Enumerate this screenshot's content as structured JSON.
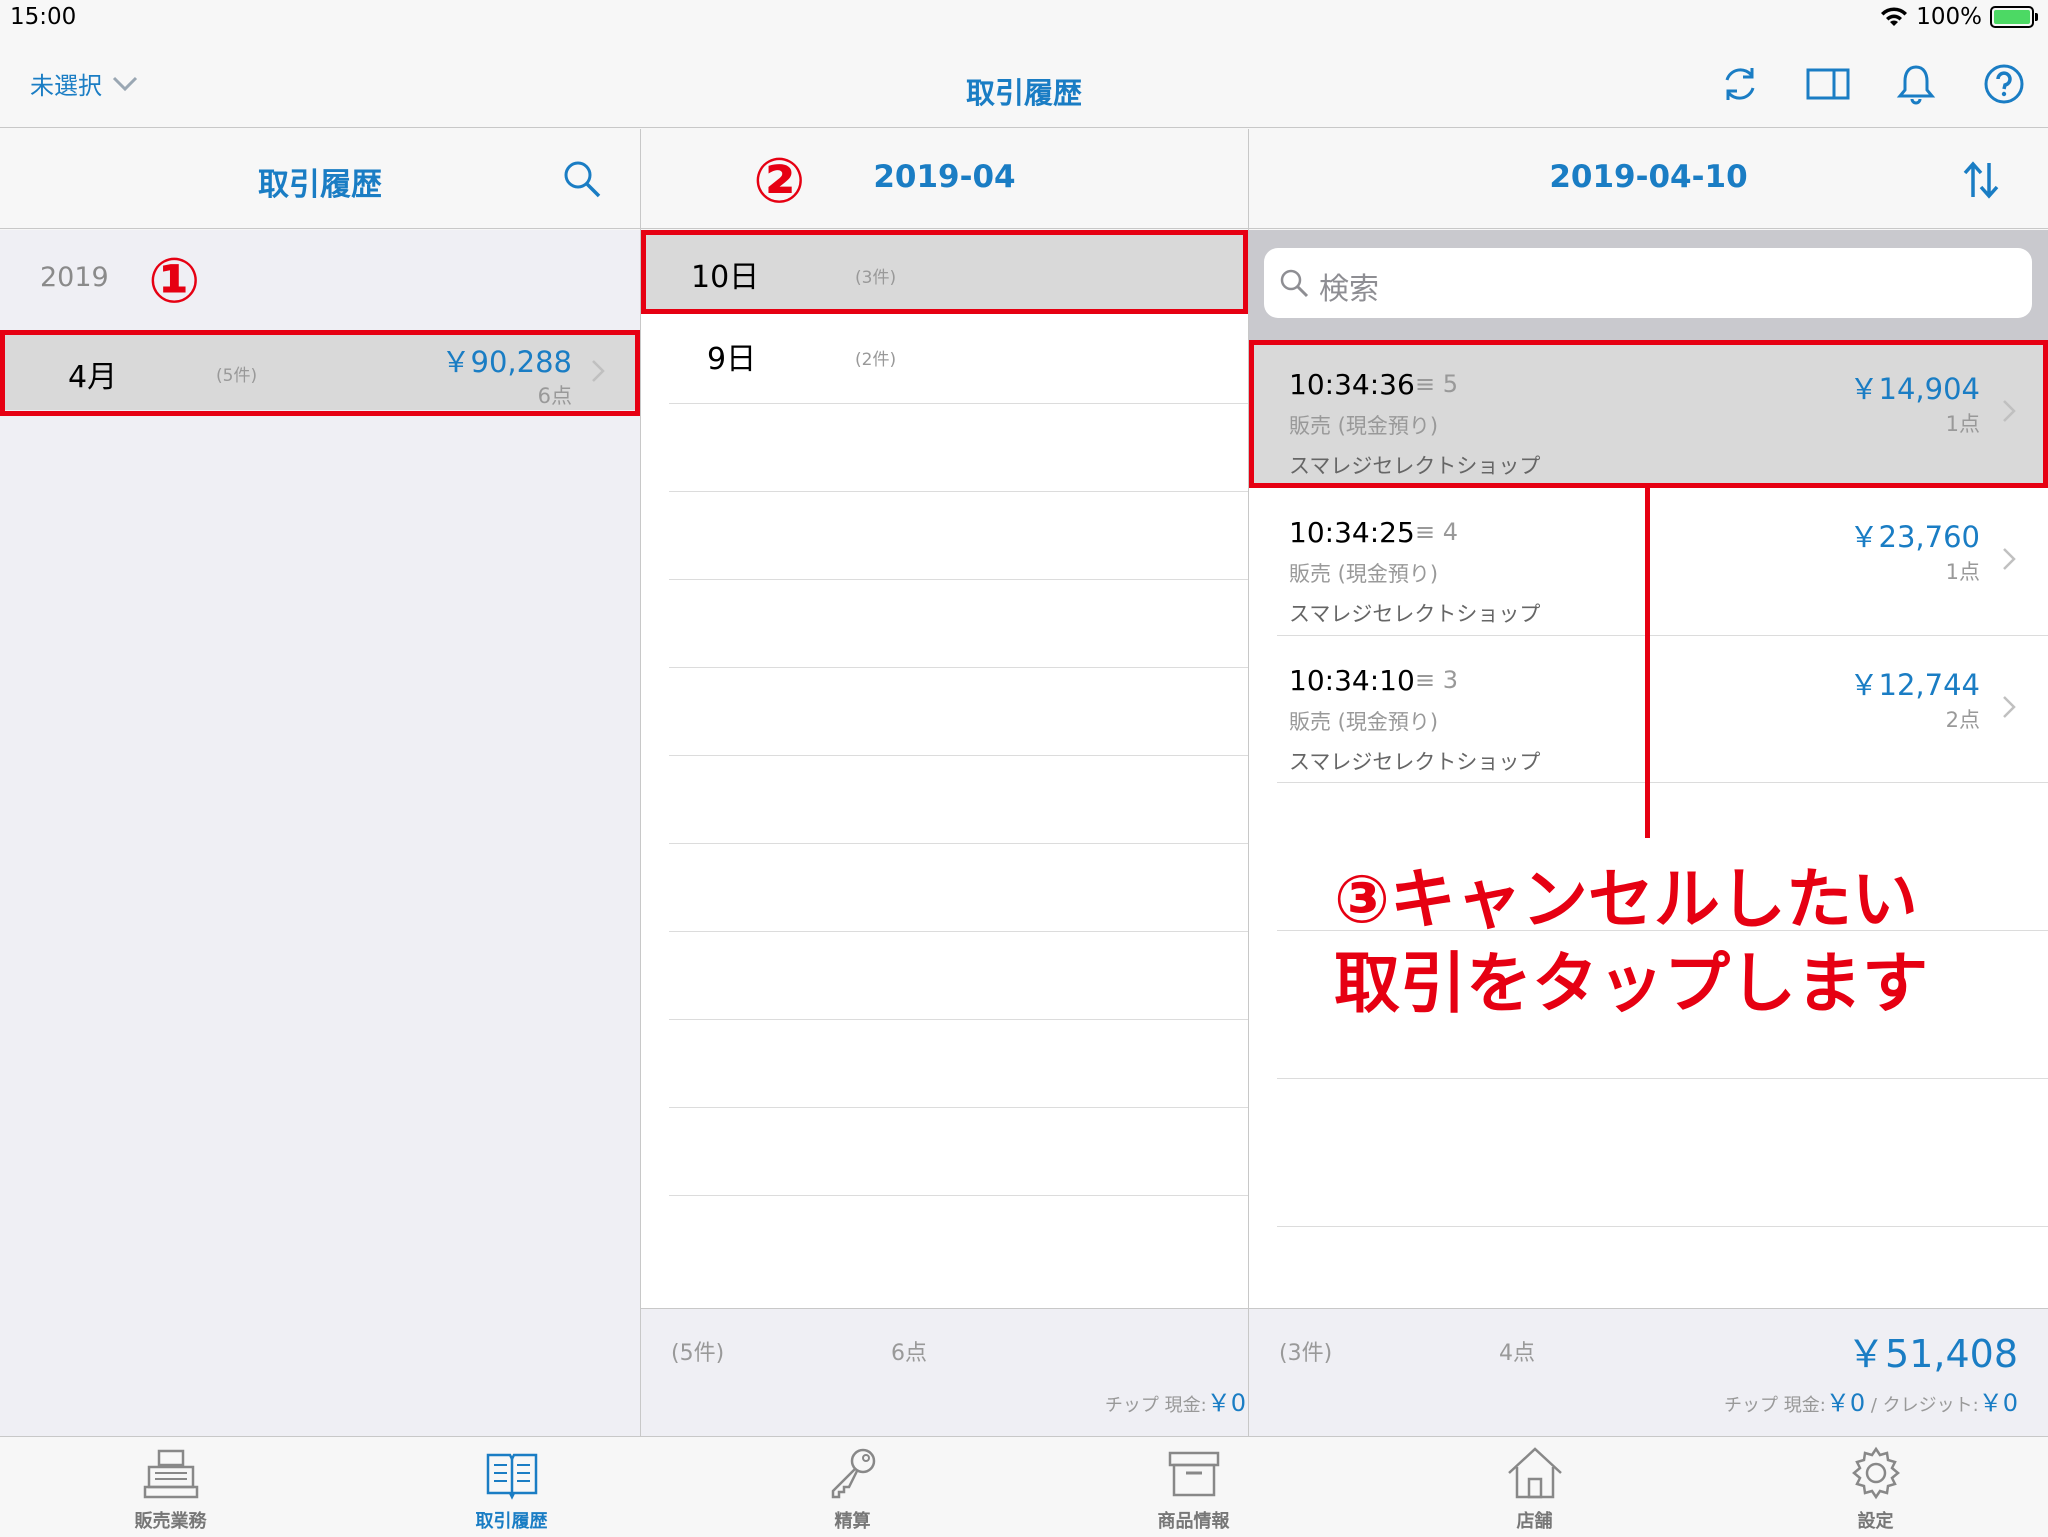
{
  "status_bar": {
    "time": "15:00",
    "battery": "100%"
  },
  "nav": {
    "store_select": "未選択",
    "title": "取引履歴"
  },
  "pane1": {
    "title": "取引履歴",
    "year": "2019",
    "month_row": {
      "label": "4月",
      "count": "(5件)",
      "amount": "￥90,288",
      "points": "6点"
    }
  },
  "pane2": {
    "title": "2019-04",
    "rows": [
      {
        "label": "10日",
        "count": "(3件)"
      },
      {
        "label": "9日",
        "count": "(2件)"
      }
    ],
    "footer": {
      "count": "(5件)",
      "points": "6点",
      "tip": "チップ 現金:",
      "tip_amount": "￥0"
    }
  },
  "pane3": {
    "title": "2019-04-10",
    "search_placeholder": "検索",
    "transactions": [
      {
        "time": "10:34:36",
        "seq": "5",
        "type": "販売 (現金預り)",
        "shop": "スマレジセレクトショップ",
        "amount": "￥14,904",
        "points": "1点"
      },
      {
        "time": "10:34:25",
        "seq": "4",
        "type": "販売 (現金預り)",
        "shop": "スマレジセレクトショップ",
        "amount": "￥23,760",
        "points": "1点"
      },
      {
        "time": "10:34:10",
        "seq": "3",
        "type": "販売 (現金預り)",
        "shop": "スマレジセレクトショップ",
        "amount": "￥12,744",
        "points": "2点"
      }
    ],
    "footer": {
      "count": "(3件)",
      "points": "4点",
      "total": "￥51,408",
      "tip": "チップ 現金:",
      "tip_cash": "￥0",
      "sep": " / ",
      "credit": "クレジット:",
      "tip_credit": "￥0"
    }
  },
  "annotations": {
    "one": "①",
    "two": "②",
    "three_line1": "③キャンセルしたい",
    "three_line2": "取引をタップします",
    "color": "#e60012"
  },
  "tabs": [
    {
      "label": "販売業務",
      "icon": "register-icon",
      "active": false
    },
    {
      "label": "取引履歴",
      "icon": "book-icon",
      "active": true
    },
    {
      "label": "精算",
      "icon": "key-icon",
      "active": false
    },
    {
      "label": "商品情報",
      "icon": "box-icon",
      "active": false
    },
    {
      "label": "店舗",
      "icon": "house-icon",
      "active": false
    },
    {
      "label": "設定",
      "icon": "gear-icon",
      "active": false
    }
  ],
  "colors": {
    "accent": "#1a7dc4",
    "highlight": "#e60012"
  }
}
